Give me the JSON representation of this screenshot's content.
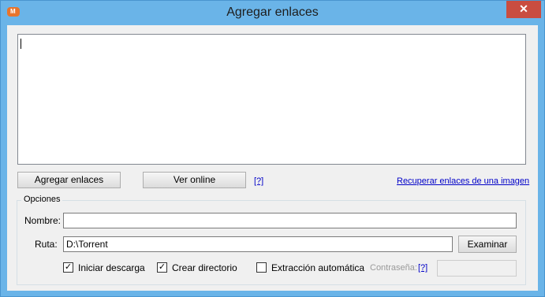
{
  "window": {
    "title": "Agregar enlaces",
    "close_glyph": "✕",
    "app_icon": "megadownloader-icon"
  },
  "links_textarea": {
    "value": ""
  },
  "actions": {
    "add_links": "Agregar enlaces",
    "view_online": "Ver online",
    "help_link": "[?]",
    "recover_from_image": "Recuperar enlaces de una imagen"
  },
  "options": {
    "group_label": "Opciones",
    "name_label": "Nombre:",
    "name_value": "",
    "path_label": "Ruta:",
    "path_value": "D:\\Torrent",
    "browse_button": "Examinar",
    "start_download": {
      "label": "Iniciar descarga",
      "checked": true
    },
    "create_directory": {
      "label": "Crear directorio",
      "checked": true
    },
    "auto_extraction": {
      "label": "Extracción automática",
      "checked": false
    },
    "password_label": "Contraseña:",
    "password_help": "[?]",
    "password_value": ""
  }
}
